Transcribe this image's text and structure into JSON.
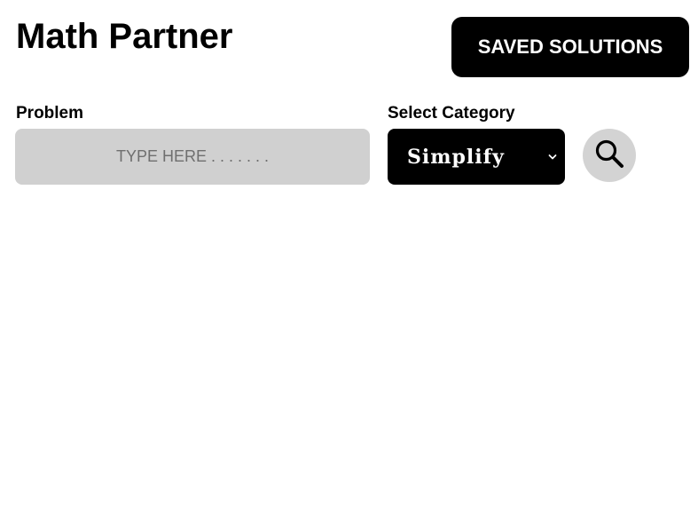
{
  "header": {
    "title": "Math Partner",
    "saved_label": "SAVED SOLUTIONS"
  },
  "problem": {
    "label": "Problem",
    "placeholder": "TYPE HERE . . . . . . .",
    "value": ""
  },
  "category": {
    "label": "Select Category",
    "selected": "Simplify"
  },
  "search": {
    "icon": "search-icon"
  },
  "colors": {
    "primary": "#000000",
    "input_bg": "#d0d0d0",
    "search_bg": "#d3d3d3",
    "background": "#ffffff"
  }
}
